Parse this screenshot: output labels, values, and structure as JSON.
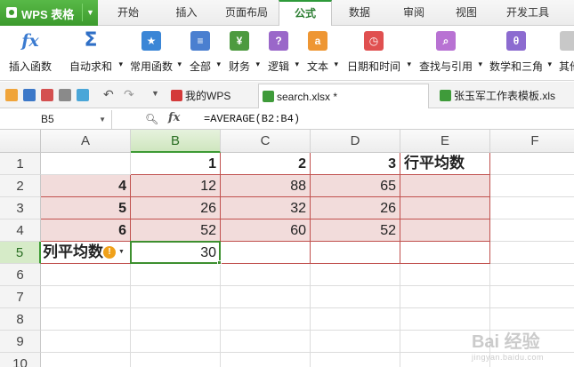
{
  "app": {
    "name": "WPS 表格"
  },
  "menu_tabs": [
    {
      "label": "开始",
      "active": false
    },
    {
      "label": "插入",
      "active": false
    },
    {
      "label": "页面布局",
      "active": false
    },
    {
      "label": "公式",
      "active": true
    },
    {
      "label": "数据",
      "active": false
    },
    {
      "label": "审阅",
      "active": false
    },
    {
      "label": "视图",
      "active": false
    },
    {
      "label": "开发工具",
      "active": false
    }
  ],
  "ribbon": [
    {
      "label": "插入函数",
      "icon": "fx-icon"
    },
    {
      "label": "自动求和",
      "icon": "sigma-icon",
      "dropdown": true
    },
    {
      "label": "常用函数",
      "icon": "star-function-icon",
      "dropdown": true
    },
    {
      "label": "全部",
      "icon": "all-functions-icon",
      "dropdown": true
    },
    {
      "label": "财务",
      "icon": "finance-icon",
      "dropdown": true
    },
    {
      "label": "逻辑",
      "icon": "logic-icon",
      "dropdown": true
    },
    {
      "label": "文本",
      "icon": "text-icon",
      "dropdown": true
    },
    {
      "label": "日期和时间",
      "icon": "clock-icon",
      "dropdown": true
    },
    {
      "label": "查找与引用",
      "icon": "search-function-icon",
      "dropdown": true
    },
    {
      "label": "数学和三角",
      "icon": "math-icon",
      "dropdown": true
    },
    {
      "label": "其他",
      "icon": "other-functions-icon"
    }
  ],
  "doc_tabs": [
    {
      "label": "我的WPS",
      "icon": "wps-home-icon",
      "active": false
    },
    {
      "label": "search.xlsx *",
      "icon": "xlsx-file-icon",
      "active": true
    },
    {
      "label": "张玉军工作表模板.xls",
      "icon": "xls-file-icon",
      "active": false
    }
  ],
  "formula_bar": {
    "name_box": "B5",
    "fx_label": "fx",
    "formula": "=AVERAGE(B2:B4)"
  },
  "sheet": {
    "columns": [
      "A",
      "B",
      "C",
      "D",
      "E",
      "F"
    ],
    "rows": [
      "1",
      "2",
      "3",
      "4",
      "5",
      "6",
      "7",
      "8",
      "9",
      "10"
    ],
    "selected_cell": "B5",
    "cells": {
      "B1": "1",
      "C1": "2",
      "D1": "3",
      "E1": "行平均数",
      "A2": "4",
      "B2": "12",
      "C2": "88",
      "D2": "65",
      "A3": "5",
      "B3": "26",
      "C3": "32",
      "D3": "26",
      "A4": "6",
      "B4": "52",
      "C4": "60",
      "D4": "52",
      "A5": "列平均数",
      "B5": "30"
    }
  },
  "watermark": {
    "brand": "Bai 经验",
    "url": "jingyan.baidu.com"
  }
}
